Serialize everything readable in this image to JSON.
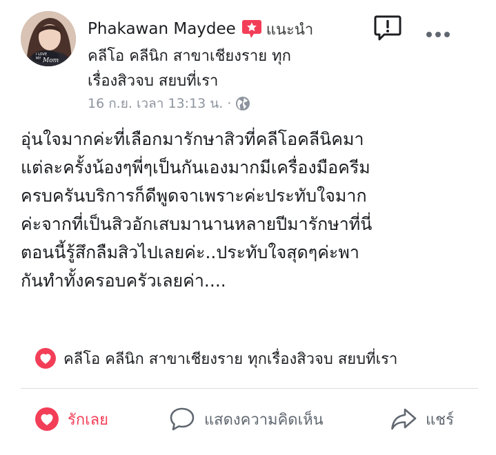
{
  "post": {
    "author": {
      "name": "Phakawan Maydee",
      "recommend_label": "แนะนำ",
      "avatar_caption": "I LOVE MY Mom"
    },
    "clinic_line_1": "คลีโอ คลีนิก สาขาเชียงราย ทุก",
    "clinic_line_2": "เรื่องสิวจบ สยบที่เรา",
    "timestamp": "16 ก.ย. เวลา 13:13 น.",
    "meta_separator": "·",
    "body_lines": [
      "อุ่นใจมากค่ะที่เลือกมารักษาสิวที่คลีโอคลีนิคมา",
      "แต่ละครั้งน้องๆพี่ๆเป็นกันเองมากมีเครื่องมือครีม",
      "ครบครันบริการก็ดีพูดจาเพราะค่ะประทับใจมาก",
      "ค่ะจากที่เป็นสิวอักเสบมานานหลายปีมารักษาที่นี่",
      "ตอนนี้รู้สึกลืมสิวไปเลยค่ะ..ประทับใจสุดๆค่ะพา",
      "กันทำทั้งครอบครัวเลยค่า...."
    ],
    "reaction_summary": "คลีโอ คลีนิก สาขาเชียงราย ทุกเรื่องสิวจบ สยบที่เรา",
    "actions": {
      "love": "รักเลย",
      "comment": "แสดงความคิดเห็น",
      "share": "แชร์"
    }
  },
  "icons": {
    "recommend": "star-badge-icon",
    "privacy": "globe-icon",
    "report": "report-icon",
    "more": "more-icon",
    "reaction": "heart-icon",
    "comment": "comment-icon",
    "share": "share-icon"
  },
  "colors": {
    "love_red": "#f33e58",
    "meta_gray": "#8d949e",
    "action_gray": "#606770",
    "text": "#1c1e21",
    "divider": "#dadde1"
  }
}
